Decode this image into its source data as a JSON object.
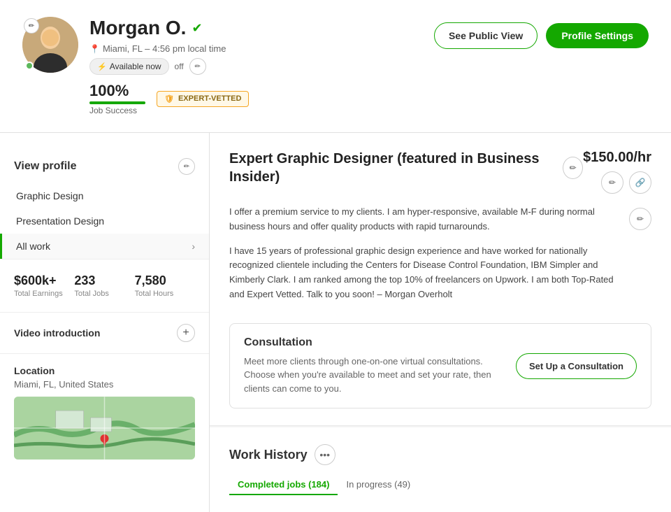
{
  "header": {
    "name": "Morgan O.",
    "verified": true,
    "location": "Miami, FL – 4:56 pm local time",
    "availability_label": "Available now",
    "availability_status": "off",
    "job_success_pct": "100%",
    "job_success_label": "Job Success",
    "expert_badge": "EXPERT-VETTED",
    "see_public_view": "See Public View",
    "profile_settings": "Profile Settings",
    "progress_width": "100"
  },
  "sidebar": {
    "view_profile": "View profile",
    "nav_items": [
      {
        "label": "Graphic Design",
        "active": false
      },
      {
        "label": "Presentation Design",
        "active": false
      },
      {
        "label": "All work",
        "active": true
      }
    ],
    "stats": [
      {
        "value": "$600k+",
        "label": "Total Earnings"
      },
      {
        "value": "233",
        "label": "Total Jobs"
      },
      {
        "value": "7,580",
        "label": "Total Hours"
      }
    ],
    "video_intro": "Video introduction",
    "location_title": "Location",
    "location_text": "Miami, FL, United States"
  },
  "content": {
    "job_title": "Expert Graphic Designer (featured in Business Insider)",
    "rate": "$150.00/hr",
    "bio1": "I offer a premium service to my clients. I am hyper-responsive, available M-F during normal business hours and offer quality products with rapid turnarounds.",
    "bio2": "I have 15 years of professional graphic design experience and have worked for nationally recognized clientele including the Centers for Disease Control Foundation, IBM Simpler and Kimberly Clark. I am ranked among the top 10% of freelancers on Upwork. I am both Top-Rated and Expert Vetted. Talk to you soon! – Morgan Overholt",
    "consultation": {
      "title": "Consultation",
      "text": "Meet more clients through one-on-one virtual consultations. Choose when you're available to meet and set your rate, then clients can come to you.",
      "button": "Set Up a Consultation"
    },
    "work_history": {
      "title": "Work History",
      "tabs": [
        {
          "label": "Completed jobs (184)",
          "active": true
        },
        {
          "label": "In progress (49)",
          "active": false
        }
      ]
    }
  },
  "icons": {
    "pencil": "✏",
    "verified_check": "✔",
    "location_pin": "📍",
    "lightning": "⚡",
    "shield": "🛡",
    "plus": "+",
    "chevron_right": "›",
    "link": "🔗",
    "more": "•••"
  }
}
